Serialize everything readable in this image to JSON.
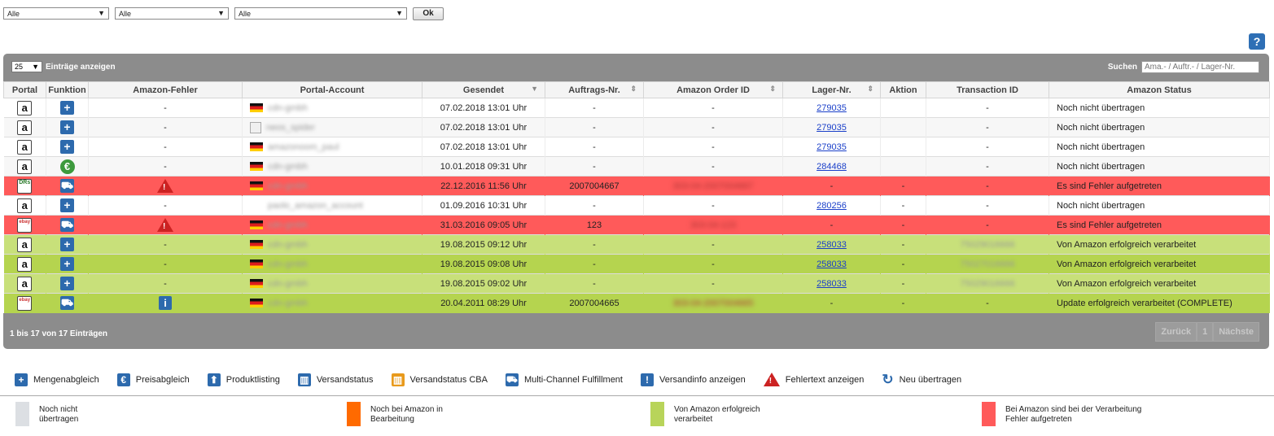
{
  "filters": {
    "select1": "Alle",
    "select2": "Alle",
    "select3": "Alle",
    "ok_label": "Ok"
  },
  "help_label": "?",
  "table_controls": {
    "page_length": "25",
    "page_length_suffix": "Einträge anzeigen",
    "search_label": "Suchen",
    "search_placeholder": "Ama.- / Auftr.- / Lager-Nr."
  },
  "columns": [
    "Portal",
    "Funktion",
    "Amazon-Fehler",
    "Portal-Account",
    "Gesendet",
    "Auftrags-Nr.",
    "Amazon Order ID",
    "Lager-Nr.",
    "Aktion",
    "Transaction ID",
    "Amazon Status"
  ],
  "rows": [
    {
      "portal": "a",
      "function": "+",
      "error": "-",
      "account": "cdn-gmbh",
      "sent": "07.02.2018 13:01 Uhr",
      "order": "-",
      "amazon_id": "-",
      "stock": "279035",
      "action": "",
      "transaction": "-",
      "status": "Noch nicht übertragen"
    },
    {
      "portal": "a",
      "function": "+",
      "error": "-",
      "account": "neos_spider",
      "sent": "07.02.2018 13:01 Uhr",
      "order": "-",
      "amazon_id": "-",
      "stock": "279035",
      "action": "",
      "transaction": "-",
      "status": "Noch nicht übertragen"
    },
    {
      "portal": "a",
      "function": "+",
      "error": "-",
      "account": "amazonoom_paul",
      "sent": "07.02.2018 13:01 Uhr",
      "order": "-",
      "amazon_id": "-",
      "stock": "279035",
      "action": "",
      "transaction": "-",
      "status": "Noch nicht übertragen"
    },
    {
      "portal": "a",
      "function": "€",
      "error": "-",
      "account": "cdn-gmbh",
      "sent": "10.01.2018 09:31 Uhr",
      "order": "-",
      "amazon_id": "-",
      "stock": "284468",
      "action": "",
      "transaction": "-",
      "status": "Noch nicht übertragen"
    },
    {
      "portal": "DRs",
      "function": "truck",
      "error": "!",
      "account": "cdn-gmbh",
      "sent": "22.12.2016 11:56 Uhr",
      "order": "2007004667",
      "amazon_id": "303-04-2007004667",
      "stock": "-",
      "action": "-",
      "transaction": "-",
      "status": "Es sind Fehler aufgetreten"
    },
    {
      "portal": "a",
      "function": "+",
      "error": "-",
      "account": "paolo_amazon_account",
      "sent": "01.09.2016 10:31 Uhr",
      "order": "-",
      "amazon_id": "-",
      "stock": "280256",
      "action": "-",
      "transaction": "-",
      "status": "Noch nicht übertragen"
    },
    {
      "portal": "ebay",
      "function": "truck",
      "error": "!",
      "account": "cdn-gmbh",
      "sent": "31.03.2016 09:05 Uhr",
      "order": "123",
      "amazon_id": "303-04-123",
      "stock": "-",
      "action": "-",
      "transaction": "-",
      "status": "Es sind Fehler aufgetreten"
    },
    {
      "portal": "a",
      "function": "+",
      "error": "-",
      "account": "cdn-gmbh",
      "sent": "19.08.2015 09:12 Uhr",
      "order": "-",
      "amazon_id": "-",
      "stock": "258033",
      "action": "-",
      "transaction": "75029016666",
      "status": "Von Amazon erfolgreich verarbeitet"
    },
    {
      "portal": "a",
      "function": "+",
      "error": "-",
      "account": "cdn-gmbh",
      "sent": "19.08.2015 09:08 Uhr",
      "order": "-",
      "amazon_id": "-",
      "stock": "258033",
      "action": "-",
      "transaction": "75027016666",
      "status": "Von Amazon erfolgreich verarbeitet"
    },
    {
      "portal": "a",
      "function": "+",
      "error": "-",
      "account": "cdn-gmbh",
      "sent": "19.08.2015 09:02 Uhr",
      "order": "-",
      "amazon_id": "-",
      "stock": "258033",
      "action": "-",
      "transaction": "75029016666",
      "status": "Von Amazon erfolgreich verarbeitet"
    },
    {
      "portal": "ebay",
      "function": "truck",
      "error": "i",
      "account": "cdn-gmbh",
      "sent": "20.04.2011 08:29 Uhr",
      "order": "2007004665",
      "amazon_id": "303-04-2007004665",
      "stock": "-",
      "action": "-",
      "transaction": "-",
      "status": "Update erfolgreich verarbeitet (COMPLETE)"
    }
  ],
  "footer": {
    "info": "1 bis 17 von 17 Einträgen",
    "prev": "Zurück",
    "page": "1",
    "next": "Nächste"
  },
  "legend_icons": [
    {
      "icon": "plus-icon",
      "glyph": "+",
      "label": "Mengenabgleich"
    },
    {
      "icon": "euro-icon",
      "glyph": "€",
      "label": "Preisabgleich"
    },
    {
      "icon": "upload-icon",
      "glyph": "⬆",
      "label": "Produktlisting"
    },
    {
      "icon": "package-icon",
      "glyph": "▥",
      "label": "Versandstatus"
    },
    {
      "icon": "package-cba-icon",
      "glyph": "▥",
      "label": "Versandstatus CBA"
    },
    {
      "icon": "truck-icon",
      "glyph": "🚚",
      "label": "Multi-Channel Fulfillment"
    },
    {
      "icon": "info-icon",
      "glyph": "!",
      "label": "Versandinfo anzeigen"
    },
    {
      "icon": "warning-icon",
      "glyph": "!",
      "label": "Fehlertext anzeigen"
    },
    {
      "icon": "refresh-icon",
      "glyph": "↻",
      "label": "Neu übertragen"
    }
  ],
  "status_legend": [
    {
      "color": "#dcdfe3",
      "label": "Noch nicht\nübertragen"
    },
    {
      "color": "#ff6a00",
      "label": "Noch bei Amazon in\nBearbeitung"
    },
    {
      "color": "#b8d45a",
      "label": "Von Amazon erfolgreich\nverarbeitet"
    },
    {
      "color": "#ff5a5a",
      "label": "Bei Amazon sind bei der Verarbeitung\nFehler aufgetreten"
    }
  ]
}
